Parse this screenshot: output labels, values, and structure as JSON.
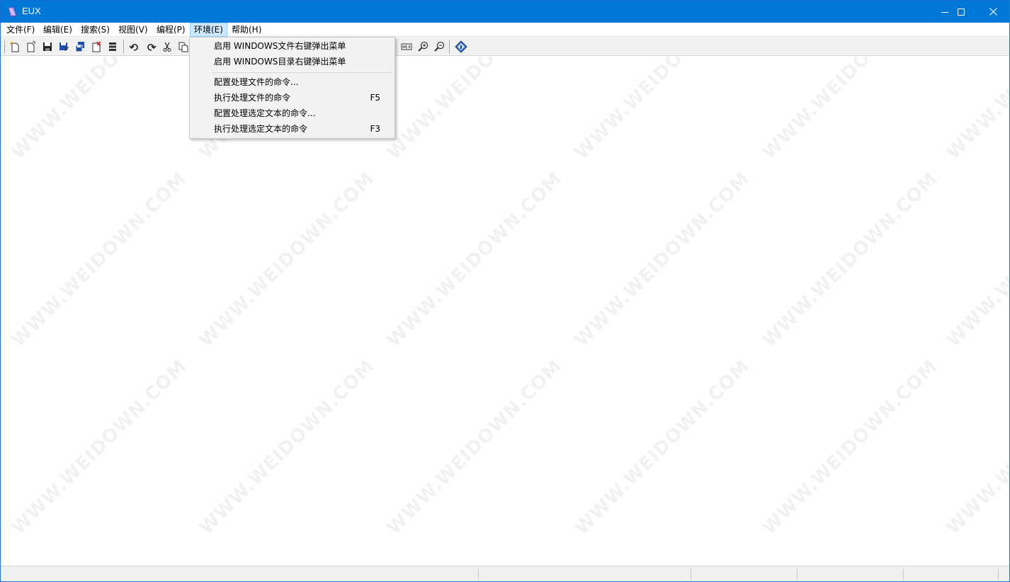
{
  "window": {
    "title": "EUX",
    "colors": {
      "titlebar": "#0078d7",
      "menu_highlight": "#cce8ff",
      "toolbar": "#f0f0f0"
    }
  },
  "menubar": {
    "items": [
      {
        "label": "文件(F)"
      },
      {
        "label": "编辑(E)"
      },
      {
        "label": "搜索(S)"
      },
      {
        "label": "视图(V)"
      },
      {
        "label": "编程(P)"
      },
      {
        "label": "环境(E)"
      },
      {
        "label": "帮助(H)"
      }
    ]
  },
  "toolbar": {
    "buttons": [
      {
        "icon": "new-file-icon"
      },
      {
        "icon": "open-file-icon"
      },
      {
        "icon": "save-icon"
      },
      {
        "icon": "save-as-icon"
      },
      {
        "icon": "save-all-icon"
      },
      {
        "icon": "close-file-icon"
      },
      {
        "icon": "properties-icon"
      },
      {
        "icon": "undo-icon"
      },
      {
        "icon": "redo-icon"
      },
      {
        "icon": "cut-icon"
      },
      {
        "icon": "copy-icon"
      },
      {
        "icon": "hex-view-icon"
      },
      {
        "icon": "zoom-in-icon"
      },
      {
        "icon": "zoom-out-icon"
      },
      {
        "icon": "help-about-icon"
      }
    ]
  },
  "env_menu": {
    "items": [
      {
        "label": "启用 WINDOWS文件右键弹出菜单",
        "shortcut": ""
      },
      {
        "label": "启用 WINDOWS目录右键弹出菜单",
        "shortcut": ""
      },
      {
        "label": "配置处理文件的命令...",
        "shortcut": ""
      },
      {
        "label": "执行处理文件的命令",
        "shortcut": "F5"
      },
      {
        "label": "配置处理选定文本的命令...",
        "shortcut": ""
      },
      {
        "label": "执行处理选定文本的命令",
        "shortcut": "F3"
      }
    ]
  },
  "watermark": {
    "text": "WWW.WEIDOWN.COM"
  }
}
